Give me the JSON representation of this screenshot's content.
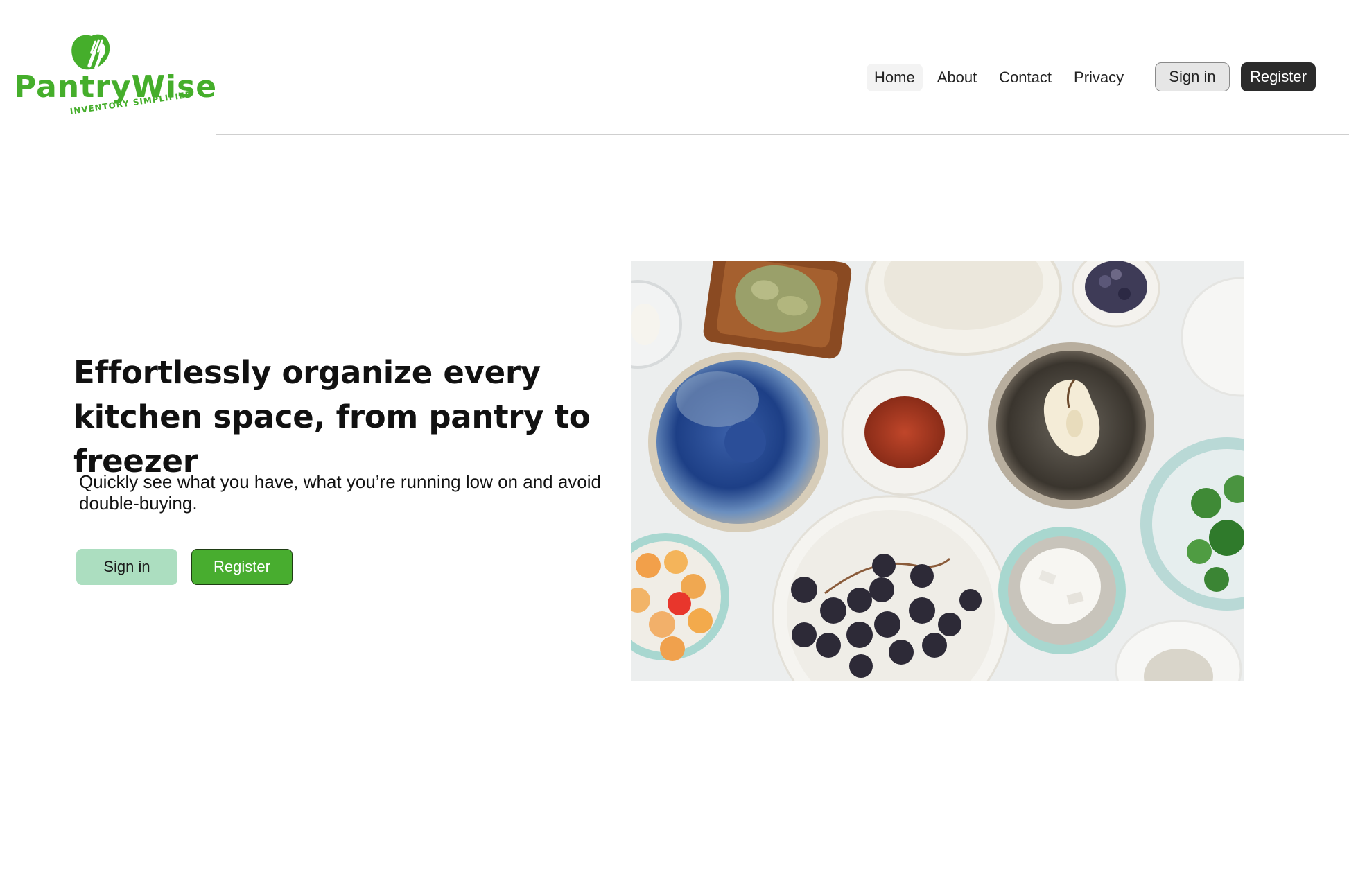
{
  "brand": {
    "name": "PantryWise",
    "tagline": "INVENTORY SIMPLIFIED",
    "color": "#45ae2b",
    "icon": "leaf-fork-logo-icon"
  },
  "nav": {
    "links": [
      {
        "label": "Home",
        "active": true
      },
      {
        "label": "About",
        "active": false
      },
      {
        "label": "Contact",
        "active": false
      },
      {
        "label": "Privacy",
        "active": false
      }
    ],
    "signin_label": "Sign in",
    "register_label": "Register"
  },
  "hero": {
    "title": "Effortlessly organize every kitchen space, from pantry to freezer",
    "subtitle": "Quickly see what you have, what you’re running low on and avoid double-buying.",
    "signin_label": "Sign in",
    "register_label": "Register",
    "image": "overhead-food-bowls-photo"
  },
  "colors": {
    "accent_green": "#48ad2f",
    "light_green": "#acdec0",
    "dark_button": "#2b2b2b"
  }
}
